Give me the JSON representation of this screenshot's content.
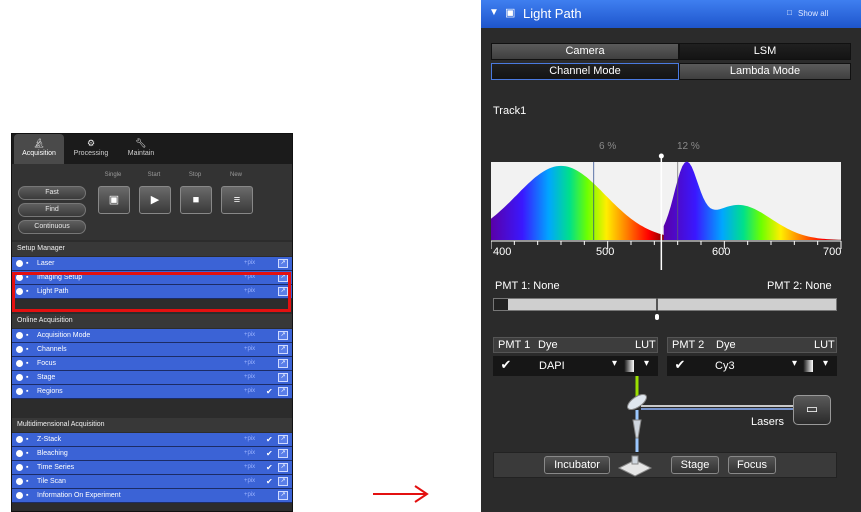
{
  "left_panel": {
    "tabs": [
      {
        "label": "Acquisition",
        "icon": "microscope-icon"
      },
      {
        "label": "Processing",
        "icon": "processing-icon"
      },
      {
        "label": "Maintain",
        "icon": "wrench-icon"
      }
    ],
    "buttons": {
      "fast": "Fast",
      "find": "Find",
      "continuous": "Continuous"
    },
    "captions": {
      "single": "Single",
      "start": "Start",
      "stop": "Stop",
      "new": "New"
    },
    "section_setup": "Setup Manager",
    "setup_items": [
      {
        "label": "Laser",
        "status": "+pix",
        "checked": false
      },
      {
        "label": "Imaging Setup",
        "status": "+pix",
        "checked": false
      },
      {
        "label": "Light Path",
        "status": "+pix",
        "checked": false
      }
    ],
    "section_online": "Online Acquisition",
    "online_items": [
      {
        "label": "Acquisition Mode",
        "status": "+pix",
        "checked": false
      },
      {
        "label": "Channels",
        "status": "+pix",
        "checked": false
      },
      {
        "label": "Focus",
        "status": "+pix",
        "checked": false
      },
      {
        "label": "Stage",
        "status": "+pix",
        "checked": false
      },
      {
        "label": "Regions",
        "status": "+pix",
        "checked": true
      }
    ],
    "section_multi": "Multidimensional Acquisition",
    "multi_items": [
      {
        "label": "Z-Stack",
        "status": "+pix",
        "checked": true
      },
      {
        "label": "Bleaching",
        "status": "+pix",
        "checked": true
      },
      {
        "label": "Time Series",
        "status": "+pix",
        "checked": true
      },
      {
        "label": "Tile Scan",
        "status": "+pix",
        "checked": true
      },
      {
        "label": "Information On Experiment",
        "status": "+pix",
        "checked": false
      }
    ],
    "highlight_color": "#e31010"
  },
  "arrow_color": "#e31010",
  "right_panel": {
    "header": {
      "title": "Light Path",
      "show_all": "Show all"
    },
    "tabs_row1": [
      "Camera",
      "LSM"
    ],
    "tabs_row2": [
      "Channel Mode",
      "Lambda Mode"
    ],
    "track_label": "Track1",
    "spectrum": {
      "pct_left": "6 %",
      "pct_right": "12 %",
      "axis_ticks": [
        "400",
        "500",
        "600",
        "700"
      ],
      "cursor_wavelength": 546,
      "axis_min": 400,
      "axis_max": 700
    },
    "pmt1_label": "PMT 1: None",
    "pmt2_label": "PMT 2: None",
    "channels": [
      {
        "name": "PMT 1",
        "dye_header": "Dye",
        "lut_header": "LUT",
        "dye": "DAPI",
        "checked": true
      },
      {
        "name": "PMT 2",
        "dye_header": "Dye",
        "lut_header": "LUT",
        "dye": "Cy3",
        "checked": true
      }
    ],
    "lasers_label": "Lasers",
    "bottom_buttons": [
      "Incubator",
      "Stage",
      "Focus"
    ]
  }
}
